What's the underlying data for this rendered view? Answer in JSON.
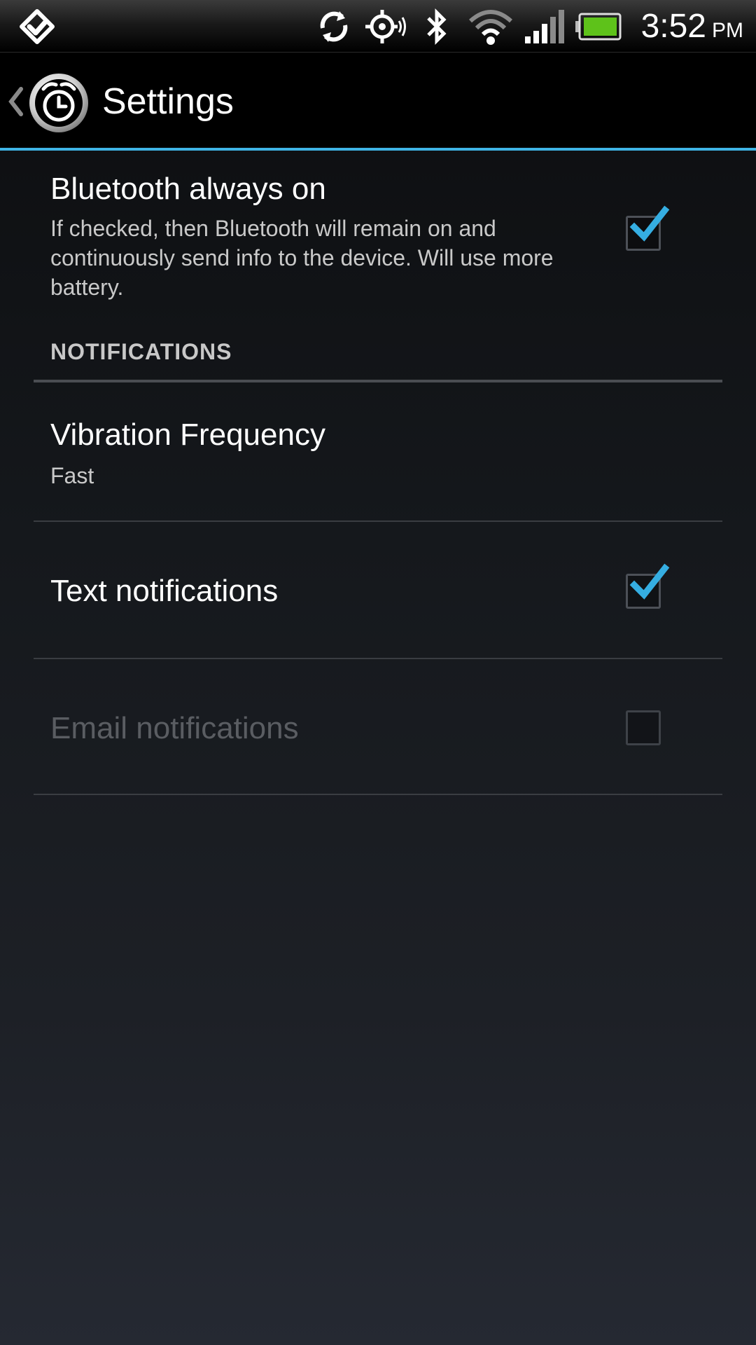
{
  "status_bar": {
    "time": "3:52",
    "ampm": "PM",
    "icons": [
      "fitbit-icon",
      "sync-icon",
      "gps-icon",
      "bluetooth-icon",
      "wifi-icon",
      "signal-icon",
      "battery-icon"
    ]
  },
  "action_bar": {
    "title": "Settings",
    "accent_color": "#3fb4e5"
  },
  "settings": {
    "bluetooth": {
      "title": "Bluetooth always on",
      "summary": "If checked, then Bluetooth will remain on and continuously send info to the device. Will use more battery.",
      "checked": true
    },
    "category_notifications": "NOTIFICATIONS",
    "vibration": {
      "title": "Vibration Frequency",
      "summary": "Fast"
    },
    "text_notifications": {
      "title": "Text notifications",
      "checked": true
    },
    "email_notifications": {
      "title": "Email notifications",
      "checked": false,
      "enabled": false
    }
  }
}
